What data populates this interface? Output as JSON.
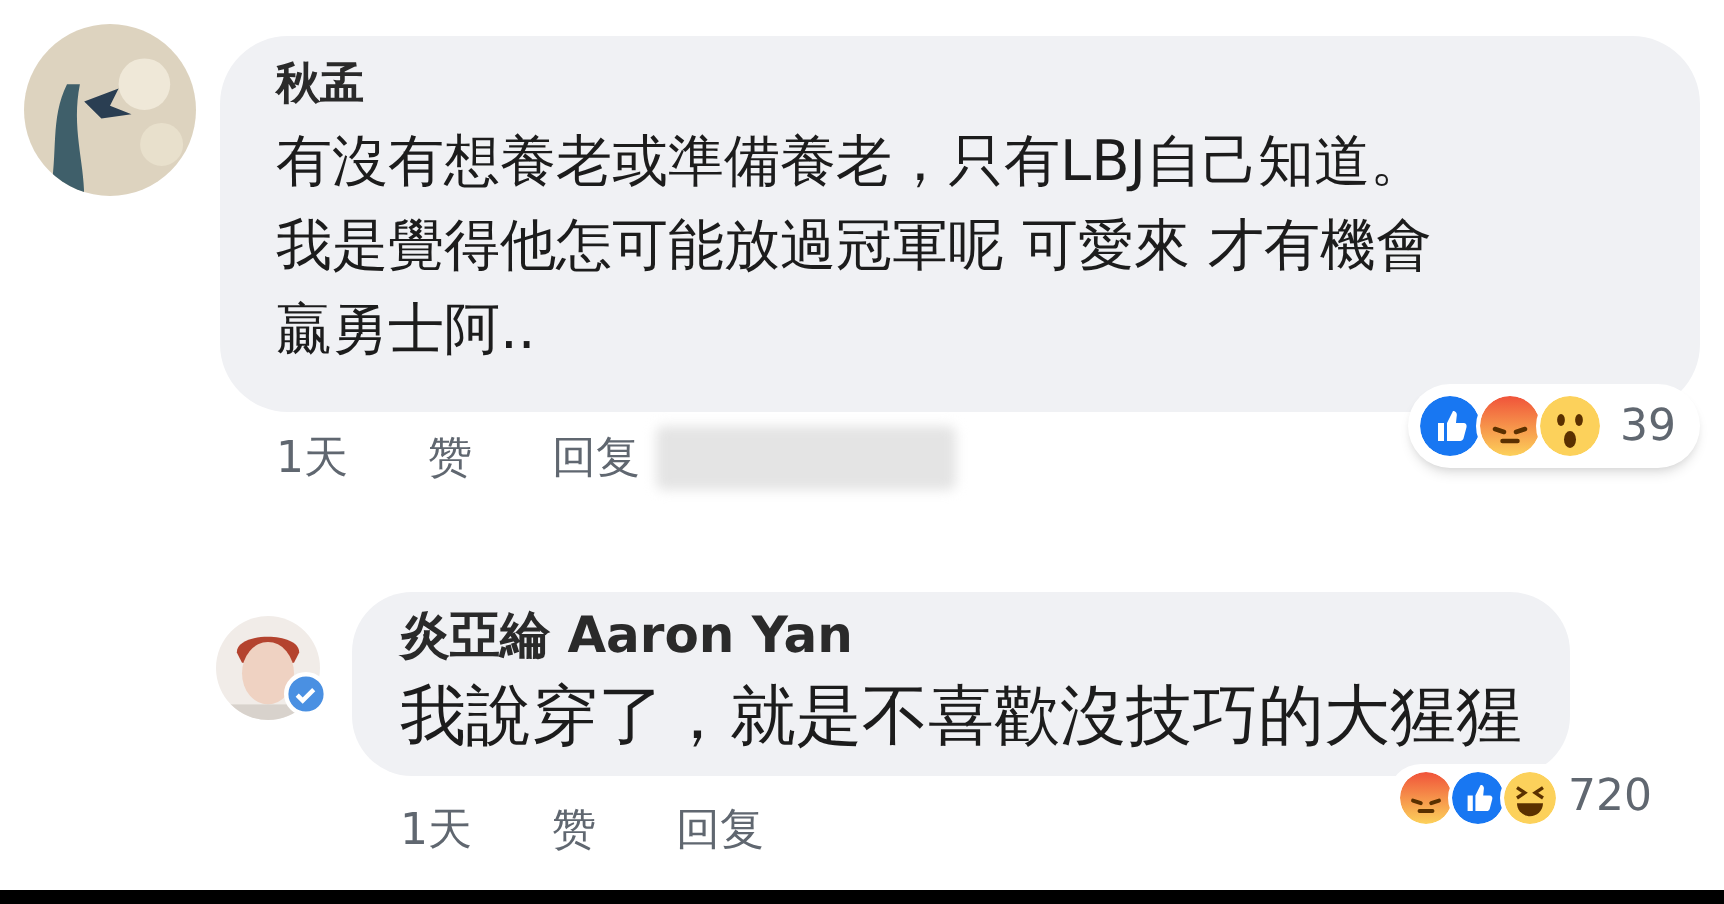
{
  "comments": [
    {
      "author": "秋孟",
      "text": "有沒有想養老或準備養老，只有LBJ自己知道。我是覺得他怎可能放過冠軍呢 可愛來 才有機會贏勇士阿..",
      "verified": false,
      "time": "1天",
      "actions": [
        "赞",
        "回复"
      ],
      "redacted": true,
      "reactions": [
        {
          "kind": "like"
        },
        {
          "kind": "angry"
        },
        {
          "kind": "wow"
        }
      ],
      "reaction_count": "39",
      "replies": [
        {
          "author": "炎亞綸 Aaron Yan",
          "text": "我說穿了，就是不喜歡沒技巧的大猩猩",
          "verified": true,
          "time": "1天",
          "actions": [
            "赞",
            "回复"
          ],
          "redacted": false,
          "reactions": [
            {
              "kind": "angry"
            },
            {
              "kind": "like"
            },
            {
              "kind": "laugh"
            }
          ],
          "reaction_count": "720"
        }
      ]
    }
  ]
}
